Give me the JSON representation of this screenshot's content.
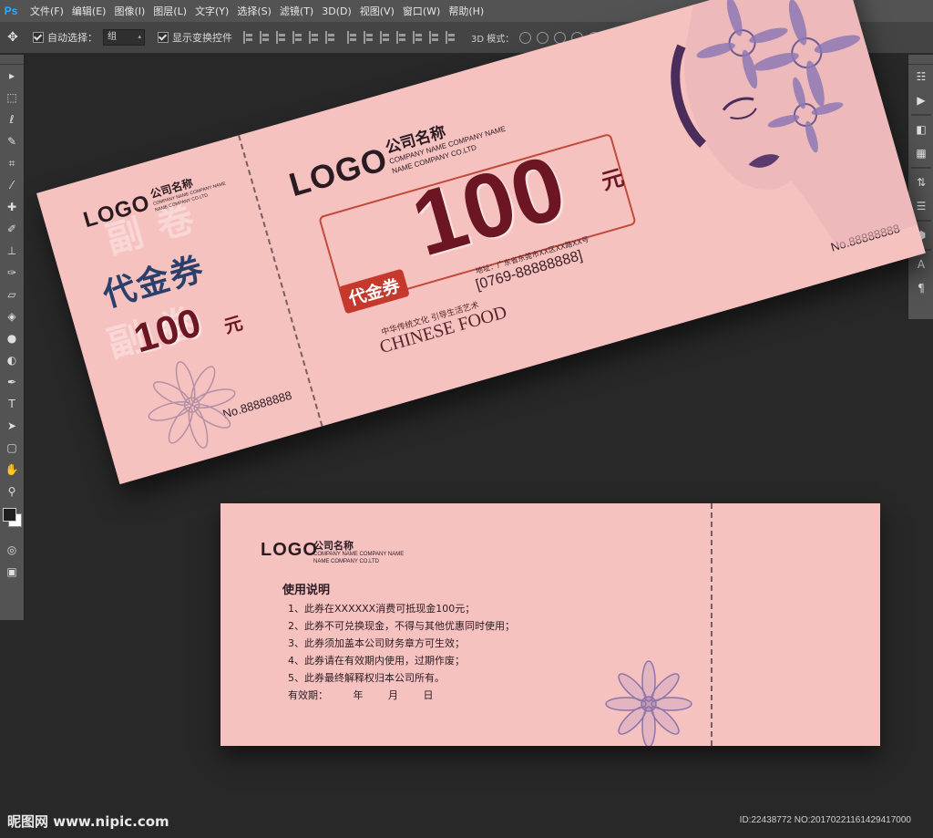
{
  "app": {
    "logo": "Ps",
    "menu": [
      "文件(F)",
      "编辑(E)",
      "图像(I)",
      "图层(L)",
      "文字(Y)",
      "选择(S)",
      "滤镜(T)",
      "3D(D)",
      "视图(V)",
      "窗口(W)",
      "帮助(H)"
    ]
  },
  "options": {
    "auto_select_label": "自动选择：",
    "auto_select_value": "组",
    "show_transform_label": "显示变换控件",
    "mode_3d_label": "3D 模式："
  },
  "icons": {
    "move": "move-icon",
    "marquee": "rect-marquee-icon",
    "lasso": "lasso-icon",
    "quick_select": "quick-select-icon",
    "crop": "crop-icon",
    "eyedropper": "eyedropper-icon",
    "healing": "healing-brush-icon",
    "brush": "brush-icon",
    "stamp": "clone-stamp-icon",
    "history": "history-brush-icon",
    "eraser": "eraser-icon",
    "bucket": "paint-bucket-icon",
    "blur": "blur-icon",
    "dodge": "dodge-icon",
    "pen": "pen-icon",
    "type": "type-icon",
    "path_select": "path-select-icon",
    "shape": "rectangle-shape-icon",
    "hand": "hand-icon",
    "zoom": "zoom-icon"
  },
  "colors": {
    "ticket_bg": "#f6c2c0",
    "amount": "#6b1622",
    "stub_title": "#2a3f6a",
    "tag": "#c5392d",
    "flower": "#6c5a94"
  },
  "ticket_front": {
    "stub": {
      "logo": "LOGO",
      "company_cn": "公司名称",
      "company_en_1": "COMPANY NAME COMPANY NAME",
      "company_en_2": "NAME COMPANY CO.LTD",
      "title": "代金券",
      "amount": "100",
      "unit": "元",
      "number": "No.88888888",
      "watermark": "副 卷"
    },
    "main": {
      "logo": "LOGO",
      "company_cn": "公司名称",
      "company_en_1": "COMPANY NAME COMPANY NAME",
      "company_en_2": "NAME COMPANY CO.LTD",
      "tag": "代金券",
      "amount": "100",
      "unit": "元",
      "address": "地址：广东省东莞市XX区XX路XX号",
      "phone": "[0769-88888888]",
      "slogan": "中华传统文化  引导生活艺术",
      "brand": "CHINESE FOOD",
      "number": "No.88888888"
    }
  },
  "ticket_back": {
    "logo": "LOGO",
    "company_cn": "公司名称",
    "company_en_1": "COMPANY NAME COMPANY NAME",
    "company_en_2": "NAME COMPANY CO.LTD",
    "rules_title": "使用说明",
    "rules": [
      "1、此券在XXXXXX消费可抵现金100元；",
      "2、此券不可兑换现金，不得与其他优惠同时使用；",
      "3、此券须加盖本公司财务章方可生效；",
      "4、此券请在有效期内使用，过期作废；",
      "5、此券最终解释权归本公司所有。"
    ],
    "validity_label": "有效期：",
    "validity_year": "年",
    "validity_month": "月",
    "validity_day": "日"
  },
  "footer": {
    "site": "昵图网 www.nipic.com",
    "id": "ID:22438772 NO:20170221161429417000"
  }
}
